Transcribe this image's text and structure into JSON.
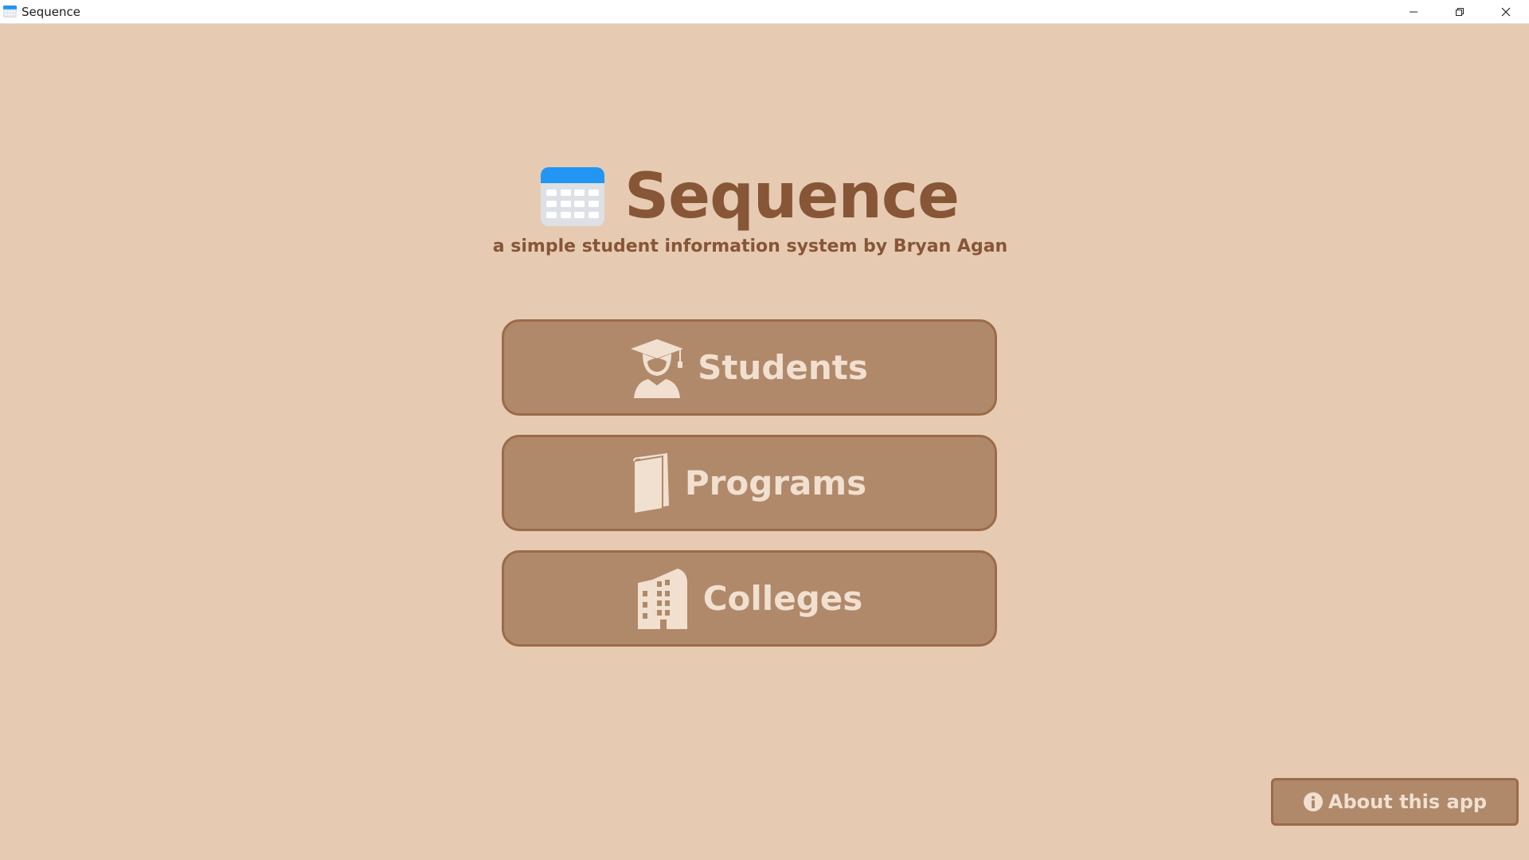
{
  "window": {
    "title": "Sequence",
    "icon": "calendar-icon",
    "controls": [
      "minimize-icon",
      "restore-icon",
      "close-icon"
    ]
  },
  "header": {
    "app_name": "Sequence",
    "logo_icon": "calendar-icon",
    "subtitle": "a simple student information system by Bryan Agan"
  },
  "nav": {
    "students": {
      "label": "Students",
      "icon": "graduate-icon"
    },
    "programs": {
      "label": "Programs",
      "icon": "book-icon"
    },
    "colleges": {
      "label": "Colleges",
      "icon": "building-icon"
    }
  },
  "about": {
    "label": "About this app",
    "icon": "info-icon"
  },
  "colors": {
    "background": "#e6cbb2",
    "accent_text": "#875637",
    "button_fill": "#b0896a",
    "button_border": "#9b6b49",
    "button_text": "#f1e0d0",
    "calendar_blue": "#2196f3"
  }
}
